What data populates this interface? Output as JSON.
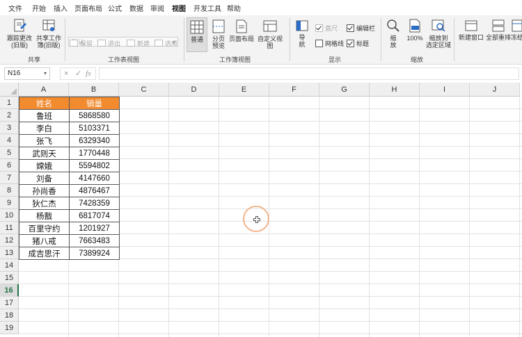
{
  "menu": [
    "文件",
    "开始",
    "插入",
    "页面布局",
    "公式",
    "数据",
    "审阅",
    "视图",
    "开发工具",
    "帮助"
  ],
  "active_menu": "视图",
  "ribbon": {
    "share": {
      "follow_change_label": "跟踪更改\n(旧版)",
      "share_workbook_label": "共享工作\n簿(旧版)",
      "group_label": "共享"
    },
    "sheet_view": {
      "select_value": "默认",
      "save_label": "保留",
      "exit_label": "退出",
      "new_label": "新建",
      "options_label": "选项",
      "group_label": "工作表视图"
    },
    "workbook_views": {
      "normal_label": "普通",
      "page_break_label": "分页\n预览",
      "page_layout_label": "页面布局",
      "custom_views_label": "自定义视图",
      "group_label": "工作簿视图"
    },
    "show": {
      "navigation_label": "导\n航",
      "ruler_label": "直尺",
      "formula_bar_label": "编辑栏",
      "gridlines_label": "网格线",
      "headings_label": "标题",
      "group_label": "显示"
    },
    "zoom": {
      "zoom_label": "缩\n放",
      "zoom100_label": "100%",
      "zoom_selection_label": "缩放到\n选定区域",
      "group_label": "缩放"
    },
    "window": {
      "new_window_label": "新建窗口",
      "arrange_all_label": "全部重排",
      "freeze_label": "冻结"
    }
  },
  "formula_bar": {
    "name_box": "N16",
    "cancel_symbol": "×",
    "enter_symbol": "✓",
    "fx_symbol": "fx",
    "formula": ""
  },
  "columns": [
    "A",
    "B",
    "C",
    "D",
    "E",
    "F",
    "G",
    "H",
    "I",
    "J"
  ],
  "rows": [
    "1",
    "2",
    "3",
    "4",
    "5",
    "6",
    "7",
    "8",
    "9",
    "10",
    "11",
    "12",
    "13",
    "14",
    "15",
    "16",
    "17",
    "18",
    "19"
  ],
  "selected_row": "16",
  "table": {
    "headers": [
      "姓名",
      "销量"
    ],
    "rows": [
      [
        "鲁班",
        "5868580"
      ],
      [
        "李白",
        "5103371"
      ],
      [
        "张飞",
        "6329340"
      ],
      [
        "武则天",
        "1770448"
      ],
      [
        "嫦娥",
        "5594802"
      ],
      [
        "刘备",
        "4147660"
      ],
      [
        "孙尚香",
        "4876467"
      ],
      [
        "狄仁杰",
        "7428359"
      ],
      [
        "杨戬",
        "6817074"
      ],
      [
        "百里守约",
        "1201927"
      ],
      [
        "猪八戒",
        "7663483"
      ],
      [
        "成吉思汗",
        "7389924"
      ]
    ]
  },
  "colors": {
    "header_fill": "#f28a2e",
    "accent": "#1f7244",
    "cursor_ring": "#f2b48a"
  }
}
